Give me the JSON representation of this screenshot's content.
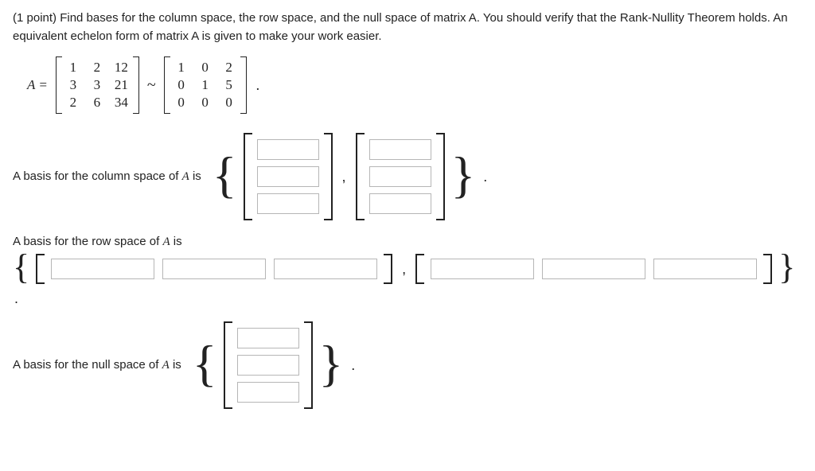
{
  "prompt": "(1 point) Find bases for the column space, the row space, and the null space of matrix A. You should verify that the Rank-Nullity Theorem holds. An equivalent echelon form of matrix A is given to make your work easier.",
  "lhs_label": "A =",
  "tilde": "~",
  "period": ".",
  "matrix_A": {
    "rows": 3,
    "cols": 3,
    "data": [
      "1",
      "2",
      "12",
      "3",
      "3",
      "21",
      "2",
      "6",
      "34"
    ]
  },
  "matrix_E": {
    "rows": 3,
    "cols": 3,
    "data": [
      "1",
      "0",
      "2",
      "0",
      "1",
      "5",
      "0",
      "0",
      "0"
    ]
  },
  "labels": {
    "col_space_pre": "A basis for the column space of ",
    "A": "A",
    "is": " is",
    "row_space_pre": "A basis for the row space of ",
    "null_space_pre": "A basis for the null space of "
  },
  "braces": {
    "left": "{",
    "right": "}"
  },
  "comma": ","
}
